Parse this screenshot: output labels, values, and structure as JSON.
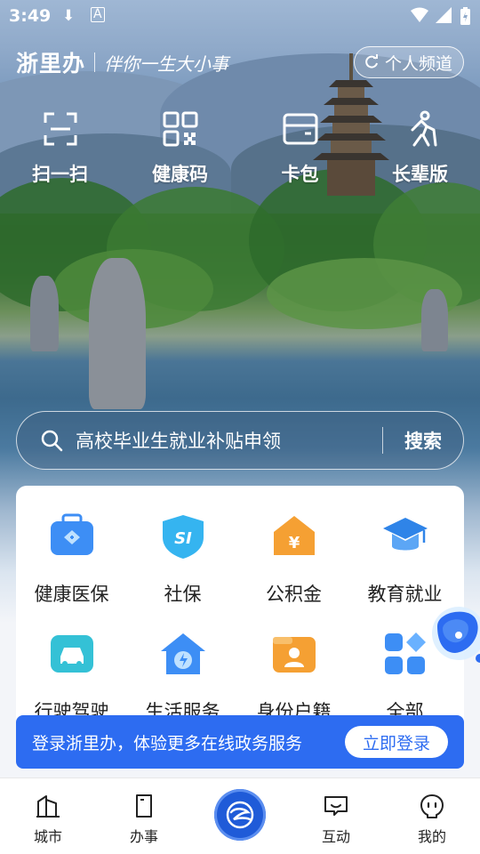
{
  "status": {
    "time": "3:49"
  },
  "brand": {
    "name": "浙里办",
    "slogan": "伴你一生大小事"
  },
  "channel_button": {
    "label": "个人频道"
  },
  "quick_actions": [
    {
      "label": "扫一扫",
      "icon": "scan-icon"
    },
    {
      "label": "健康码",
      "icon": "qr-code-icon"
    },
    {
      "label": "卡包",
      "icon": "card-wallet-icon"
    },
    {
      "label": "长辈版",
      "icon": "elder-mode-icon"
    }
  ],
  "search": {
    "placeholder": "高校毕业生就业补贴申领",
    "button_label": "搜索"
  },
  "services": [
    {
      "label": "健康医保",
      "icon": "medical-insurance-icon"
    },
    {
      "label": "社保",
      "icon": "social-security-icon"
    },
    {
      "label": "公积金",
      "icon": "housing-fund-icon"
    },
    {
      "label": "教育就业",
      "icon": "education-icon"
    },
    {
      "label": "行驶驾驶",
      "icon": "car-icon"
    },
    {
      "label": "生活服务",
      "icon": "life-service-icon"
    },
    {
      "label": "身份户籍",
      "icon": "identity-icon"
    },
    {
      "label": "全部",
      "icon": "all-services-icon"
    }
  ],
  "login_banner": {
    "text": "登录浙里办，体验更多在线政务服务",
    "button_label": "立即登录"
  },
  "bottom_nav": {
    "items": [
      {
        "label": "城市",
        "icon": "city-icon"
      },
      {
        "label": "办事",
        "icon": "affairs-icon"
      },
      {
        "label": "",
        "icon": "zheli-logo-icon"
      },
      {
        "label": "互动",
        "icon": "chat-icon"
      },
      {
        "label": "我的",
        "icon": "profile-icon"
      }
    ]
  },
  "colors": {
    "accent": "#2d6cf1",
    "primary_dark": "#1f5bd8"
  }
}
